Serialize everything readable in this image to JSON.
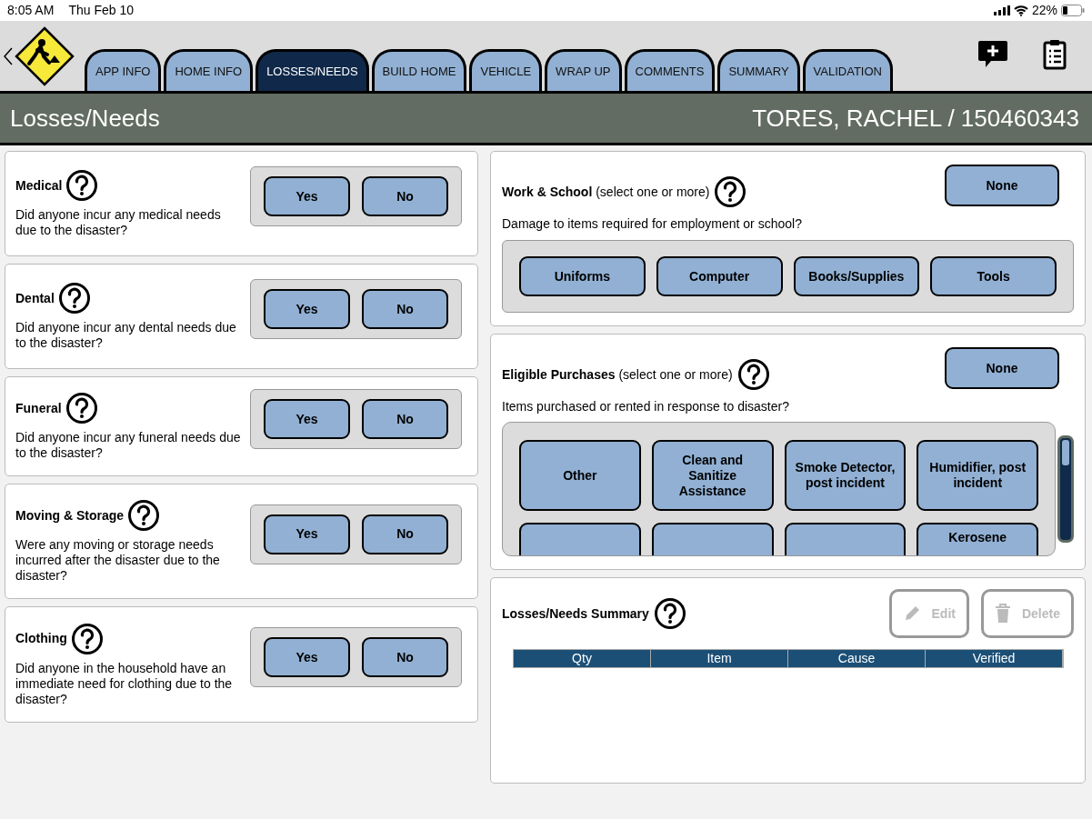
{
  "status_bar": {
    "time": "8:05 AM",
    "date": "Thu Feb 10",
    "battery": "22%"
  },
  "tabs": [
    {
      "label": "APP INFO",
      "selected": false
    },
    {
      "label": "HOME INFO",
      "selected": false
    },
    {
      "label": "LOSSES/NEEDS",
      "selected": true
    },
    {
      "label": "BUILD HOME",
      "selected": false
    },
    {
      "label": "VEHICLE",
      "selected": false
    },
    {
      "label": "WRAP UP",
      "selected": false
    },
    {
      "label": "COMMENTS",
      "selected": false
    },
    {
      "label": "SUMMARY",
      "selected": false
    },
    {
      "label": "VALIDATION",
      "selected": false
    }
  ],
  "title_bar": {
    "title": "Losses/Needs",
    "applicant": "TORES, RACHEL / 150460343"
  },
  "questions": [
    {
      "title": "Medical",
      "text": "Did anyone incur any medical needs due to the disaster?",
      "buttons": [
        "Yes",
        "No"
      ]
    },
    {
      "title": "Dental",
      "text": "Did anyone incur any dental needs due to the disaster?",
      "buttons": [
        "Yes",
        "No"
      ]
    },
    {
      "title": "Funeral",
      "text": "Did anyone incur any funeral needs due to the disaster?",
      "buttons": [
        "Yes",
        "No"
      ]
    },
    {
      "title": "Moving & Storage",
      "text": "Were any moving or storage needs incurred after the disaster due to the disaster?",
      "buttons": [
        "Yes",
        "No"
      ]
    },
    {
      "title": "Clothing",
      "text": "Did anyone in the household have an immediate need for clothing due to the disaster?",
      "buttons": [
        "Yes",
        "No"
      ]
    }
  ],
  "multi_sections": [
    {
      "title": "Work & School",
      "hint": "(select one or more)",
      "none_button": "None",
      "text": "Damage to items required for employment or school?",
      "options": [
        {
          "kind": "full",
          "label": "Uniforms"
        },
        {
          "kind": "full",
          "label": "Computer"
        },
        {
          "kind": "full",
          "label": "Books/Supplies"
        },
        {
          "kind": "full",
          "label": "Tools"
        }
      ],
      "scrollable": false
    },
    {
      "title": "Eligible Purchases",
      "hint": "(select one or more)",
      "none_button": "None",
      "text": "Items purchased or rented in response to disaster?",
      "options": [
        {
          "kind": "full",
          "label": "Other"
        },
        {
          "kind": "full",
          "label": "Clean and Sanitize Assistance"
        },
        {
          "kind": "full",
          "label": "Smoke Detector, post incident"
        },
        {
          "kind": "full",
          "label": "Humidifier, post incident"
        },
        {
          "kind": "blank"
        },
        {
          "kind": "blank"
        },
        {
          "kind": "blank"
        },
        {
          "kind": "partial",
          "label": "Kerosene"
        }
      ],
      "scrollable": true
    }
  ],
  "summary": {
    "title": "Losses/Needs Summary",
    "actions": [
      {
        "label": "Edit",
        "kind": "edit",
        "disabled": true
      },
      {
        "label": "Delete",
        "kind": "delete",
        "disabled": true
      }
    ],
    "columns": [
      "Qty",
      "Item",
      "Cause",
      "Verified"
    ]
  }
}
